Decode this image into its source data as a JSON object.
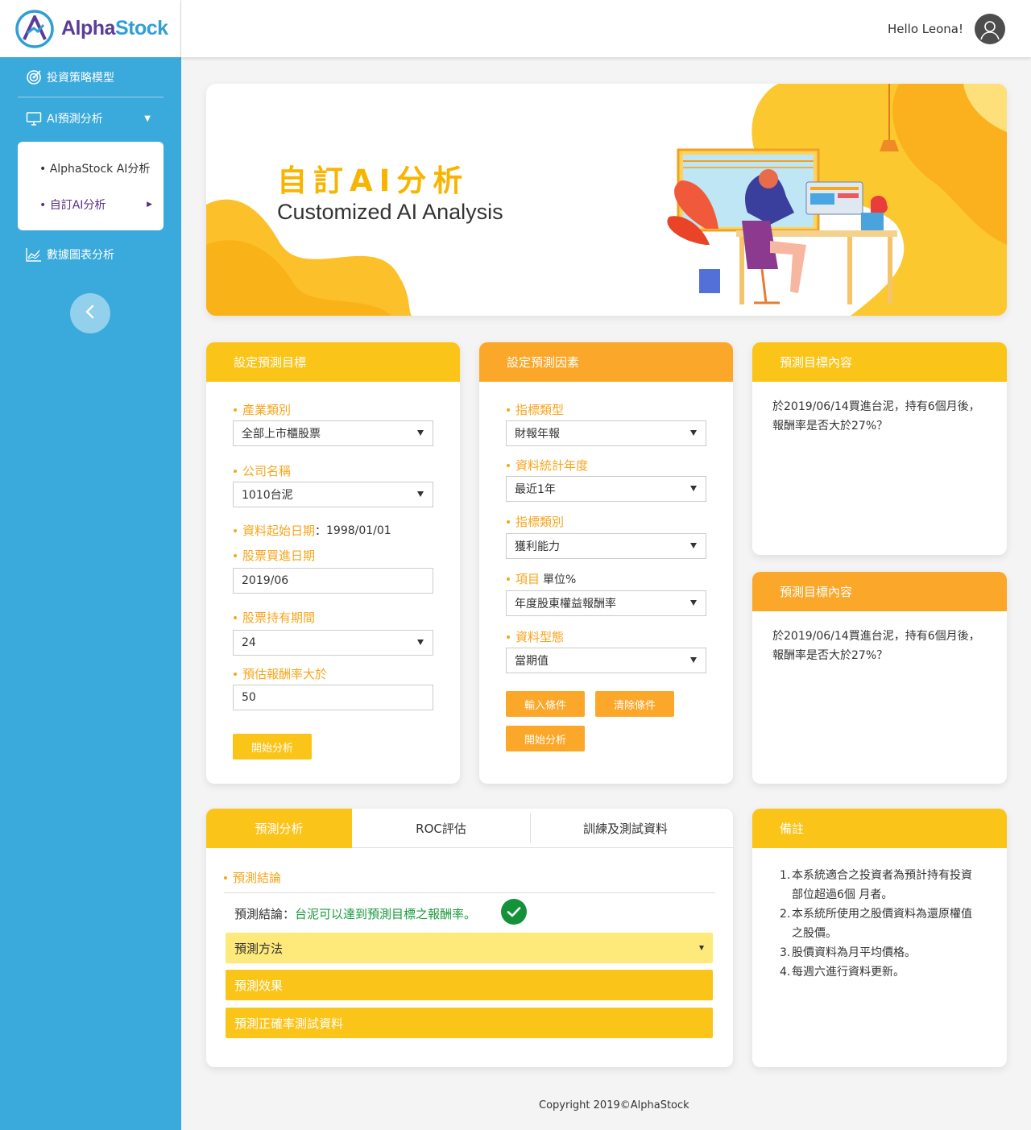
{
  "brand": {
    "name_part1": "Alpha",
    "name_part2": "Stock",
    "primary_color": "#3aa9db",
    "accent_yellow": "#fbc419",
    "accent_orange": "#fba72a"
  },
  "header": {
    "greeting": "Hello Leona!",
    "avatar_icon": "user-avatar-icon"
  },
  "sidebar": {
    "items": [
      {
        "label": "投資策略模型",
        "icon": "target-icon"
      },
      {
        "label": "AI預測分析",
        "icon": "monitor-icon",
        "expanded": true,
        "children": [
          {
            "label": "• AlphaStock AI分析"
          },
          {
            "label": "• 自訂AI分析",
            "active": true
          }
        ]
      },
      {
        "label": "數據圖表分析",
        "icon": "line-chart-icon"
      }
    ],
    "collapse_icon": "chevron-left-icon"
  },
  "banner": {
    "title_zh": "自訂AI分析",
    "title_en": "Customized AI Analysis"
  },
  "target_card": {
    "title": "設定預測目標",
    "industry_label": "產業類別",
    "industry_value": "全部上市櫃股票",
    "company_label": "公司名稱",
    "company_value": "1010台泥",
    "start_date_label": "資料起始日期",
    "start_date_sep": "：",
    "start_date_value": "1998/01/01",
    "buy_date_label": "股票買進日期",
    "buy_date_value": "2019/06",
    "hold_label": "股票持有期間",
    "hold_value": "24",
    "return_label": "預估報酬率大於",
    "return_value": "50",
    "start_button": "開始分析"
  },
  "factor_card": {
    "title": "設定預測因素",
    "indicator_type_label": "指標類型",
    "indicator_type_value": "財報年報",
    "stat_year_label": "資料統計年度",
    "stat_year_value": "最近1年",
    "indicator_cat_label": "指標類別",
    "indicator_cat_value": "獲利能力",
    "item_label": "項目",
    "item_unit": "單位%",
    "item_value": "年度股東權益報酬率",
    "data_type_label": "資料型態",
    "data_type_value": "當期值",
    "input_button": "輸入條件",
    "clear_button": "清除條件",
    "start_button": "開始分析"
  },
  "target_content_1": {
    "title": "預測目標內容",
    "line1": "於2019/06/14買進台泥，持有6個月後，",
    "line2": "報酬率是否大於27%？"
  },
  "target_content_2": {
    "title": "預測目標內容",
    "line1": "於2019/06/14買進台泥，持有6個月後，",
    "line2": "報酬率是否大於27%？"
  },
  "result_card": {
    "tabs": [
      "預測分析",
      "ROC評估",
      "訓練及測試資料"
    ],
    "section_label": "預測結論",
    "conclusion_label": "預測結論：",
    "conclusion_value": "台泥可以達到預測目標之報酬率。",
    "conclusion_color": "#1a9a3c",
    "accordions": [
      "預測方法",
      "預測效果",
      "預測正確率測試資料"
    ]
  },
  "notes_card": {
    "title": "備註",
    "items": [
      {
        "num": "1.",
        "line1": "本系統適合之投資者為預計持有投資",
        "line2": "部位超過6個 月者。"
      },
      {
        "num": "2.",
        "line1": "本系統所使用之股價資料為還原權值",
        "line2": "之股價。"
      },
      {
        "num": "3.",
        "line1": "股價資料為月平均價格。",
        "line2": ""
      },
      {
        "num": "4.",
        "line1": "每週六進行資料更新。",
        "line2": ""
      }
    ]
  },
  "footer": {
    "text": "Copyright 2019©AlphaStock"
  }
}
